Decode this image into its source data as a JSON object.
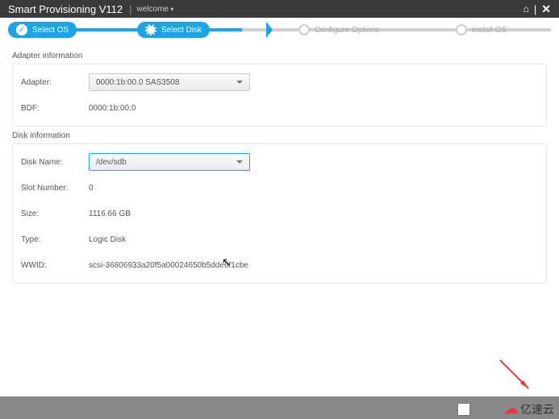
{
  "header": {
    "title": "Smart Provisioning V112",
    "welcome": "welcome"
  },
  "steps": [
    {
      "label": "Select OS",
      "state": "done"
    },
    {
      "label": "Select Disk",
      "state": "current"
    },
    {
      "label": "Configure Options",
      "state": "pending"
    },
    {
      "label": "Install OS",
      "state": "pending"
    }
  ],
  "adapter_section": {
    "title": "Adapter information",
    "fields": {
      "adapter_label": "Adapter:",
      "adapter_value": "0000:1b:00.0   SAS3508",
      "bdf_label": "BDF:",
      "bdf_value": "0000:1b:00.0"
    }
  },
  "disk_section": {
    "title": "Disk information",
    "fields": {
      "disk_name_label": "Disk Name:",
      "disk_name_value": "/dev/sdb",
      "slot_label": "Slot Number:",
      "slot_value": "0",
      "size_label": "Size:",
      "size_value": "1116.66 GB",
      "type_label": "Type:",
      "type_value": "Logic Disk",
      "wwid_label": "WWID:",
      "wwid_value": "scsi-36806933a20f5a00024650b5dde6f1cbe"
    }
  },
  "watermark": "亿速云"
}
